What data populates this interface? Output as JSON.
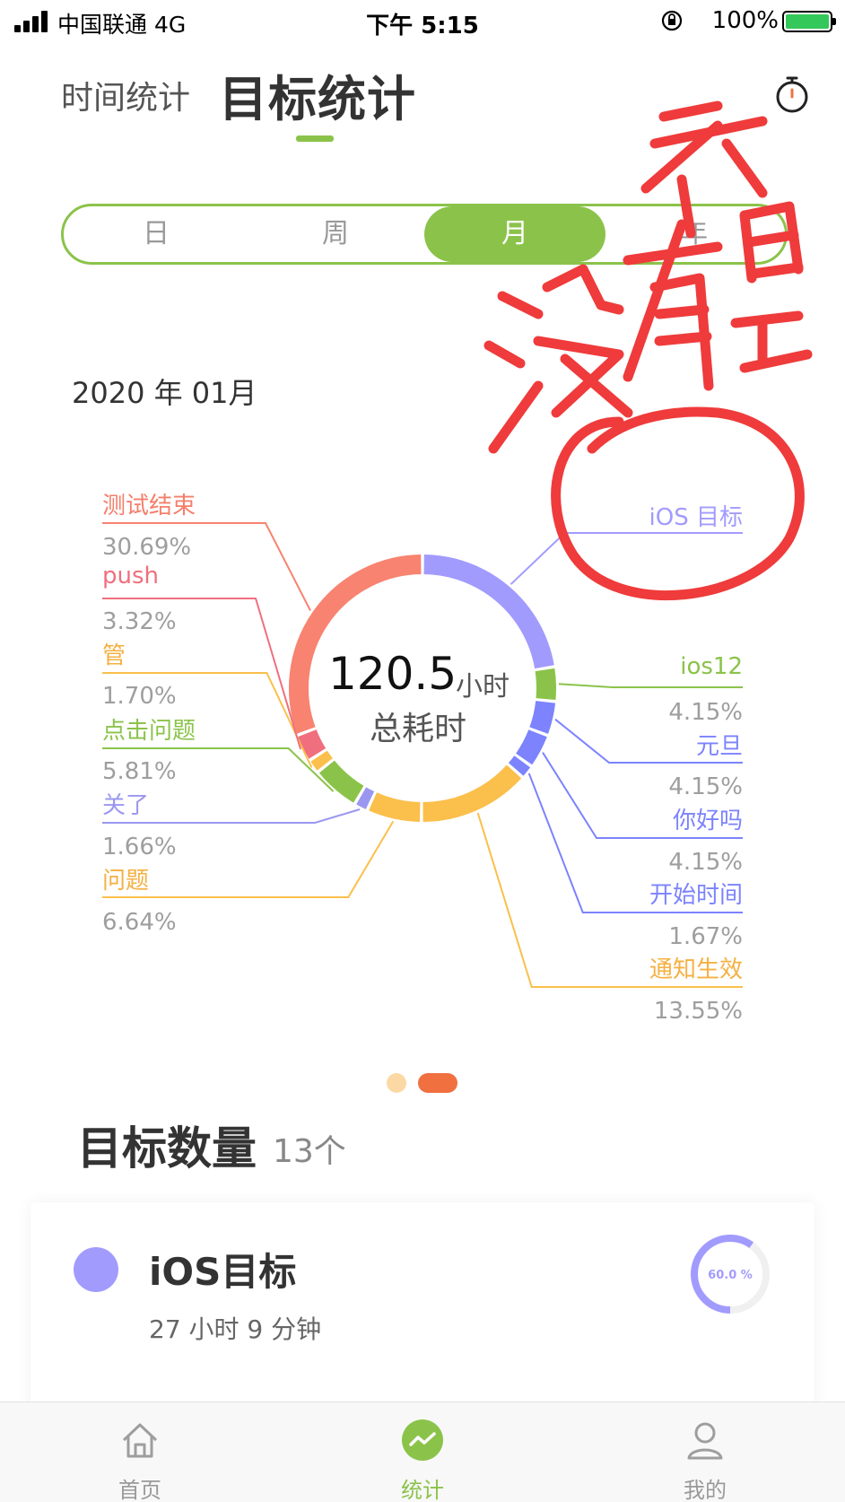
{
  "status_bar": {
    "carrier": "中国联通  4G",
    "time": "下午 5:15",
    "battery": "100%"
  },
  "header": {
    "tab_inactive": "时间统计",
    "tab_active": "目标统计",
    "timer_icon": "stopwatch-icon"
  },
  "period_tabs": [
    {
      "label": "日",
      "active": false
    },
    {
      "label": "周",
      "active": false
    },
    {
      "label": "月",
      "active": true
    },
    {
      "label": "年",
      "active": false
    }
  ],
  "date_label": "2020 年 01月",
  "summary": {
    "value": "120.5",
    "unit": "小时",
    "label": "总耗时"
  },
  "chart_data": {
    "type": "pie",
    "center_text": "120.5 小时 总耗时",
    "slices": [
      {
        "name": "iOS 目标",
        "percent": 22.41,
        "percent_label": "",
        "color": "#a29bfe"
      },
      {
        "name": "ios12",
        "percent": 4.15,
        "percent_label": "4.15%",
        "color": "#8bc34a"
      },
      {
        "name": "元旦",
        "percent": 4.15,
        "percent_label": "4.15%",
        "color": "#7c83fd"
      },
      {
        "name": "你好吗",
        "percent": 4.15,
        "percent_label": "4.15%",
        "color": "#7c83fd"
      },
      {
        "name": "开始时间",
        "percent": 1.67,
        "percent_label": "1.67%",
        "color": "#7c83fd"
      },
      {
        "name": "通知生效",
        "percent": 13.55,
        "percent_label": "13.55%",
        "color": "#fbbf4b"
      },
      {
        "name": "问题",
        "percent": 6.64,
        "percent_label": "6.64%",
        "color": "#fbbf4b"
      },
      {
        "name": "关了",
        "percent": 1.66,
        "percent_label": "1.66%",
        "color": "#9b97f0"
      },
      {
        "name": "点击问题",
        "percent": 5.81,
        "percent_label": "5.81%",
        "color": "#8bc34a"
      },
      {
        "name": "管",
        "percent": 1.7,
        "percent_label": "1.70%",
        "color": "#fbbf4b"
      },
      {
        "name": "push",
        "percent": 3.32,
        "percent_label": "3.32%",
        "color": "#f06f7e"
      },
      {
        "name": "测试结束",
        "percent": 30.69,
        "percent_label": "30.69%",
        "color": "#f88370"
      }
    ]
  },
  "pager": {
    "pages": 2,
    "active": 2
  },
  "goal_count": {
    "title": "目标数量",
    "value": "13个"
  },
  "goal_card": {
    "name": "iOS目标",
    "time": "27 小时 9 分钟",
    "progress_label": "60.0 %",
    "progress": 0.6,
    "color": "#a29bfe"
  },
  "handwriting": {
    "text": "不是 没有 目",
    "color": "#ef3b3b"
  },
  "tabbar": [
    {
      "label": "首页",
      "icon": "home-icon",
      "active": false
    },
    {
      "label": "统计",
      "icon": "chart-trend-icon",
      "active": true
    },
    {
      "label": "我的",
      "icon": "profile-icon",
      "active": false
    }
  ]
}
